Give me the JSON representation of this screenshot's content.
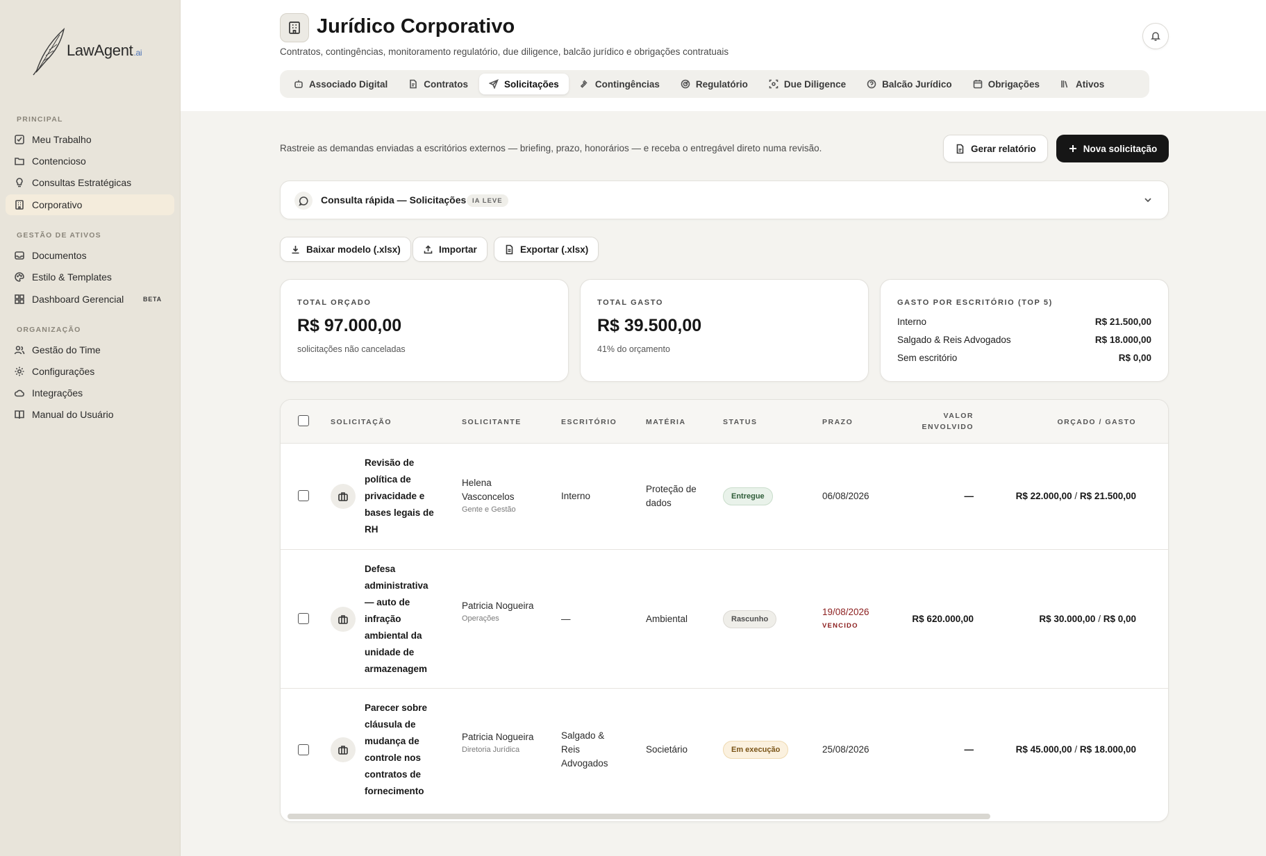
{
  "brand": {
    "name": "LawAgent",
    "suffix": ".ai"
  },
  "sidebar": {
    "sections": [
      {
        "label": "PRINCIPAL",
        "items": [
          {
            "label": "Meu Trabalho",
            "icon": "checkbox-icon"
          },
          {
            "label": "Contencioso",
            "icon": "folder-icon"
          },
          {
            "label": "Consultas Estratégicas",
            "icon": "lightbulb-icon"
          },
          {
            "label": "Corporativo",
            "icon": "building-icon",
            "active": true
          }
        ]
      },
      {
        "label": "GESTÃO DE ATIVOS",
        "items": [
          {
            "label": "Documentos",
            "icon": "inbox-icon"
          },
          {
            "label": "Estilo & Templates",
            "icon": "palette-icon"
          },
          {
            "label": "Dashboard Gerencial",
            "icon": "dashboard-icon",
            "badge": "BETA"
          }
        ]
      },
      {
        "label": "ORGANIZAÇÃO",
        "items": [
          {
            "label": "Gestão do Time",
            "icon": "users-icon"
          },
          {
            "label": "Configurações",
            "icon": "gear-icon"
          },
          {
            "label": "Integrações",
            "icon": "cloud-icon"
          },
          {
            "label": "Manual do Usuário",
            "icon": "book-icon"
          }
        ]
      }
    ]
  },
  "header": {
    "title": "Jurídico Corporativo",
    "subtitle": "Contratos, contingências, monitoramento regulatório, due diligence, balcão jurídico e obrigações contratuais",
    "tabs": [
      {
        "label": "Associado Digital",
        "icon": "robot-icon"
      },
      {
        "label": "Contratos",
        "icon": "document-icon"
      },
      {
        "label": "Solicitações",
        "icon": "send-icon",
        "active": true
      },
      {
        "label": "Contingências",
        "icon": "gavel-icon"
      },
      {
        "label": "Regulatório",
        "icon": "radar-icon"
      },
      {
        "label": "Due Diligence",
        "icon": "scan-icon"
      },
      {
        "label": "Balcão Jurídico",
        "icon": "help-icon"
      },
      {
        "label": "Obrigações",
        "icon": "calendar-icon"
      },
      {
        "label": "Ativos",
        "icon": "library-icon"
      }
    ]
  },
  "actions": {
    "description": "Rastreie as demandas enviadas a escritórios externos — briefing, prazo, honorários — e receba o entregável direto numa revisão.",
    "report_label": "Gerar relatório",
    "new_label": "Nova solicitação"
  },
  "quick": {
    "label": "Consulta rápida — Solicitações",
    "badge": "IA LEVE"
  },
  "files": {
    "download_label": "Baixar modelo (.xlsx)",
    "import_label": "Importar",
    "export_label": "Exportar (.xlsx)"
  },
  "kpis": {
    "budget": {
      "label": "TOTAL ORÇADO",
      "value": "R$ 97.000,00",
      "sub": "solicitações não canceladas"
    },
    "spent": {
      "label": "TOTAL GASTO",
      "value": "R$ 39.500,00",
      "sub": "41% do orçamento"
    },
    "by_firm": {
      "label": "GASTO POR ESCRITÓRIO (TOP 5)",
      "rows": [
        {
          "name": "Interno",
          "value": "R$ 21.500,00"
        },
        {
          "name": "Salgado & Reis Advogados",
          "value": "R$ 18.000,00"
        },
        {
          "name": "Sem escritório",
          "value": "R$ 0,00"
        }
      ]
    }
  },
  "table": {
    "headers": {
      "request": "SOLICITAÇÃO",
      "requester": "SOLICITANTE",
      "firm": "ESCRITÓRIO",
      "matter": "MATÉRIA",
      "status": "STATUS",
      "deadline": "PRAZO",
      "value_1": "VALOR",
      "value_2": "ENVOLVIDO",
      "budget": "ORÇADO / GASTO"
    },
    "rows": [
      {
        "title": "Revisão de política de privacidade e bases legais de RH",
        "requester": "Helena Vasconcelos",
        "area": "Gente e Gestão",
        "firm": "Interno",
        "matter": "Proteção de dados",
        "status": "Entregue",
        "deadline": "06/08/2026",
        "value": "—",
        "budgeted": "R$ 22.000,00",
        "spent": "R$ 21.500,00"
      },
      {
        "title": "Defesa administrativa — auto de infração ambiental da unidade de armazenagem",
        "requester": "Patricia Nogueira",
        "area": "Operações",
        "firm": "—",
        "matter": "Ambiental",
        "status": "Rascunho",
        "deadline": "19/08/2026",
        "deadline_tag": "VENCIDO",
        "value": "R$ 620.000,00",
        "budgeted": "R$ 30.000,00",
        "spent": "R$ 0,00"
      },
      {
        "title": "Parecer sobre cláusula de mudança de controle nos contratos de fornecimento",
        "requester": "Patricia Nogueira",
        "area": "Diretoria Jurídica",
        "firm": "Salgado & Reis Advogados",
        "matter": "Societário",
        "status": "Em execução",
        "deadline": "25/08/2026",
        "value": "—",
        "budgeted": "R$ 45.000,00",
        "spent": "R$ 18.000,00"
      }
    ]
  }
}
